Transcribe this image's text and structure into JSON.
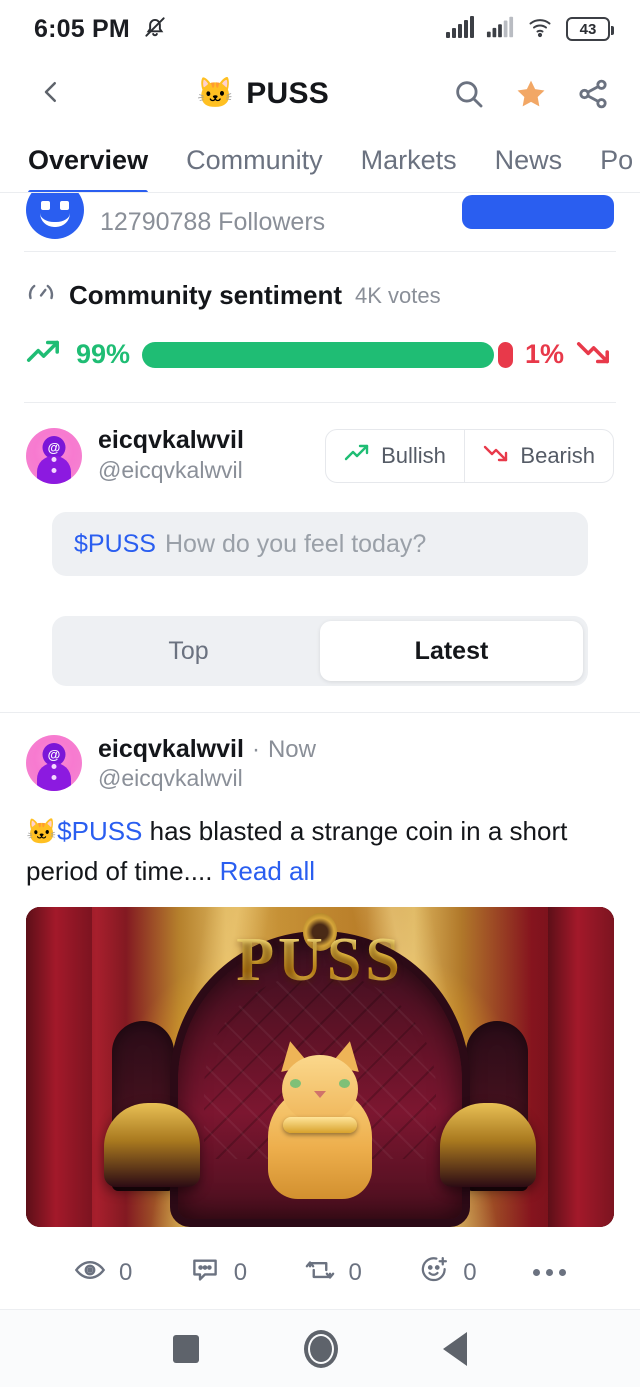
{
  "status_bar": {
    "time": "6:05 PM",
    "mute_icon": "bell-muted-icon",
    "signal_icon": "signal-bars-icon",
    "signal2_icon": "signal-bars-secondary-icon",
    "wifi_icon": "wifi-icon",
    "battery_level": "43"
  },
  "header": {
    "back_icon": "chevron-left-icon",
    "coin_emoji": "🐱",
    "title": "PUSS",
    "search_icon": "search-icon",
    "favorite_icon": "star-filled-icon",
    "share_icon": "share-icon",
    "star_color": "#f2a765"
  },
  "tabs": [
    {
      "label": "Overview",
      "active": true
    },
    {
      "label": "Community",
      "active": false
    },
    {
      "label": "Markets",
      "active": false
    },
    {
      "label": "News",
      "active": false
    },
    {
      "label": "Po",
      "active": false
    }
  ],
  "followers_row": {
    "count_label": "12790788 Followers",
    "avatar_icon": "coin-profile-avatar",
    "follow_button_label": "",
    "button_color": "#2a5ef0"
  },
  "sentiment": {
    "icon": "gauge-icon",
    "title": "Community sentiment",
    "votes": "4K votes",
    "bullish_percent": "99%",
    "bearish_percent": "1%",
    "bullish_color": "#1fbd74",
    "bearish_color": "#e8394a",
    "up_arrow_icon": "trend-up-icon",
    "down_arrow_icon": "trend-down-icon"
  },
  "composer": {
    "user_name": "eicqvkalwvil",
    "user_handle": "@eicqvkalwvil",
    "avatar_icon": "user-avatar",
    "bullish_label": "Bullish",
    "bearish_label": "Bearish",
    "bullish_icon": "trend-up-icon",
    "bearish_icon": "trend-down-icon",
    "input_ticker": "$PUSS",
    "input_placeholder": "How do you feel today?"
  },
  "feed_filter": {
    "options": [
      {
        "label": "Top",
        "active": false
      },
      {
        "label": "Latest",
        "active": true
      }
    ]
  },
  "post": {
    "author_name": "eicqvkalwvil",
    "separator": "·",
    "time": "Now",
    "author_handle": "@eicqvkalwvil",
    "avatar_icon": "user-avatar",
    "emoji": "🐱",
    "ticker": "$PUSS",
    "body": " has blasted a strange coin in a short period of time....",
    "read_all_label": "Read all",
    "image": {
      "alt_name": "puss-throne-artwork",
      "title_text": "PUSS"
    },
    "actions": [
      {
        "icon": "eye-icon",
        "count": "0"
      },
      {
        "icon": "comment-icon",
        "count": "0"
      },
      {
        "icon": "repost-icon",
        "count": "0"
      },
      {
        "icon": "reaction-add-icon",
        "count": "0"
      }
    ],
    "more_icon": "more-horizontal-icon"
  },
  "nav_bar": {
    "recents_icon": "square-recents-icon",
    "home_icon": "circle-home-icon",
    "back_icon": "triangle-back-icon"
  }
}
